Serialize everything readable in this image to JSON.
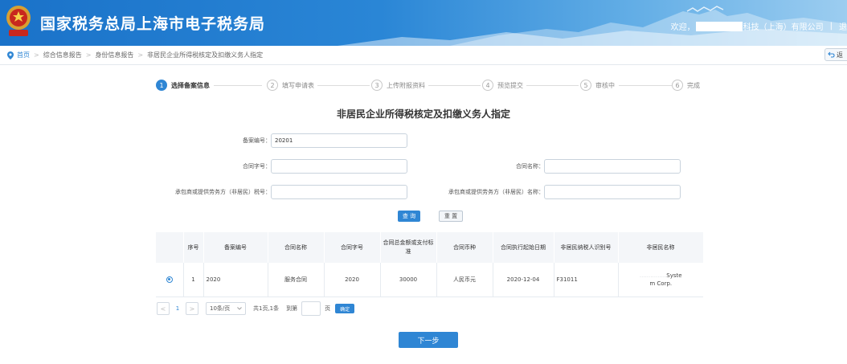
{
  "header": {
    "site_title": "国家税务总局上海市电子税务局",
    "welcome_prefix": "欢迎，",
    "company_suffix": "科技（上海）有限公司",
    "separator": "|",
    "logout_partial": "退"
  },
  "breadcrumb": {
    "home": "首页",
    "items": [
      "综合信息报告",
      "身份信息报告",
      "非居民企业所得税核定及扣缴义务人指定"
    ],
    "back_label": "返"
  },
  "steps": [
    {
      "num": "1",
      "label": "选择备案信息",
      "active": true
    },
    {
      "num": "2",
      "label": "填写申请表",
      "active": false
    },
    {
      "num": "3",
      "label": "上传附报资料",
      "active": false
    },
    {
      "num": "4",
      "label": "预览提交",
      "active": false
    },
    {
      "num": "5",
      "label": "审核中",
      "active": false
    },
    {
      "num": "6",
      "label": "完成",
      "active": false
    }
  ],
  "form": {
    "title": "非居民企业所得税核定及扣缴义务人指定",
    "record_no_label": "备案编号：",
    "record_no_value": "20201",
    "contract_no_label": "合同字号：",
    "contract_no_value": "",
    "contract_name_label": "合同名称：",
    "contract_name_value": "",
    "tax_id_label": "承包商或提供劳务方（非居民）税号：",
    "tax_id_value": "",
    "provider_name_label": "承包商或提供劳务方（非居民）名称：",
    "provider_name_value": ""
  },
  "buttons": {
    "query": "查 询",
    "reset": "重 置",
    "next": "下一步"
  },
  "table": {
    "headers": [
      "",
      "序号",
      "备案编号",
      "合同名称",
      "合同字号",
      "合同总金额或支付标准",
      "合同币种",
      "合同执行起始日期",
      "非居民纳税人识别号",
      "非居民名称"
    ],
    "rows": [
      {
        "seq": "1",
        "record_no": "2020",
        "contract_name": "服务合同",
        "contract_no": "2020",
        "amount": "30000",
        "currency": "人民币元",
        "start_date": "2020-12-04",
        "tax_id": "F31011",
        "name_faded": "...............",
        "name_line1": "Syste",
        "name_line2": "m Corp."
      }
    ]
  },
  "pager": {
    "prev": "<",
    "current": "1",
    "next": ">",
    "page_size": "10条/页",
    "summary": "共1页,1条",
    "goto_prefix": "到第",
    "goto_suffix": "页",
    "confirm": "确定"
  }
}
